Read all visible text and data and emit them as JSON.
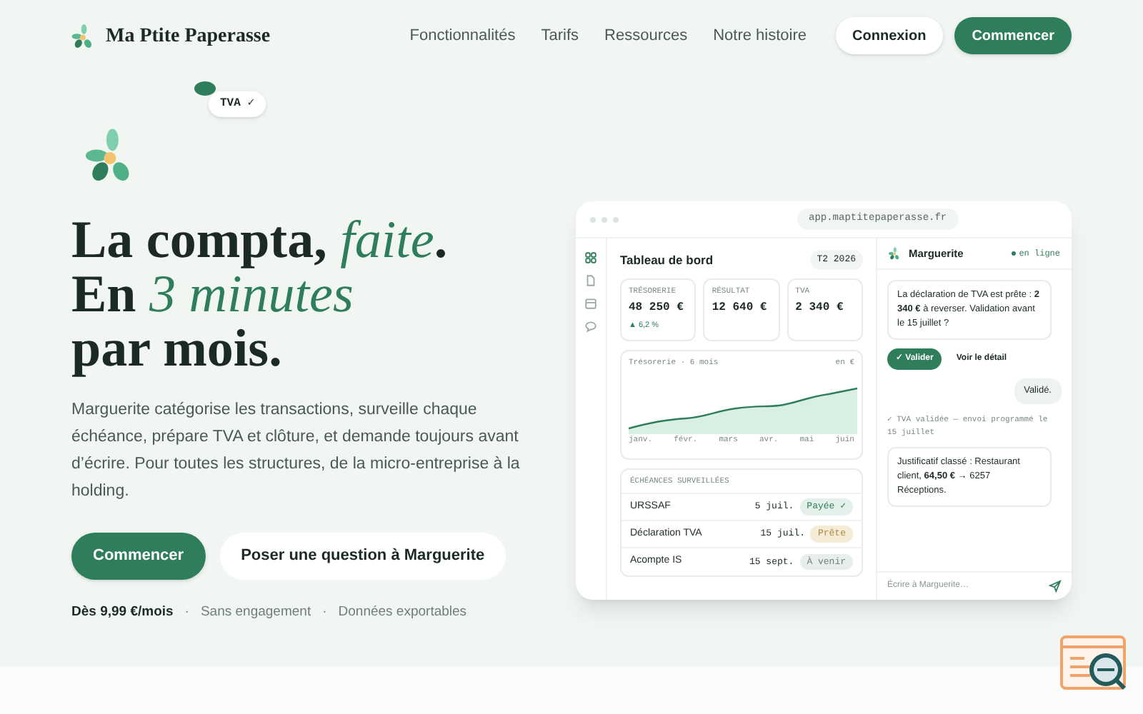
{
  "brand": "Ma Ptite Paperasse",
  "nav": [
    "Fonctionnalités",
    "Tarifs",
    "Ressources",
    "Notre histoire"
  ],
  "login": "Connexion",
  "cta": "Commencer",
  "floating_tag": "TVA ✓",
  "headline": [
    {
      "text": "La compta, ",
      "accent": "faite",
      "end": "."
    },
    {
      "text": "En ",
      "accent": "3 minutes"
    },
    {
      "text": "par mois."
    }
  ],
  "intro": "Marguerite catégorise les transactions, surveille chaque échéance, prépare TVA et clôture, et demande toujours avant d’écrire. Pour toutes les structures, de la micro-entreprise à la holding.",
  "primary_button": "Commencer",
  "secondary_button": "Poser une question à Marguerite",
  "perks": [
    "Dès 9,99 €/mois",
    "Sans engagement",
    "Données exportables"
  ],
  "perk_separator": "·",
  "app": {
    "url": "app.maptitepaperasse.fr",
    "sidebar": [
      {
        "selected": true
      },
      {
        "selected": false
      },
      {
        "selected": false
      },
      {
        "selected": false
      }
    ],
    "title": "Tableau de bord",
    "period": "T2 2026",
    "kpis": [
      {
        "label": "TRÉSORERIE",
        "value": "48 250 €",
        "delta": "▲ 6,2 %"
      },
      {
        "label": "RÉSULTAT",
        "value": "12 640 €"
      },
      {
        "label": "TVA",
        "value": "2 340 €"
      }
    ],
    "chart": {
      "title": "Trésorerie · 6 mois",
      "unit": "en €",
      "months": [
        "janv.",
        "févr.",
        "mars",
        "avr.",
        "mai",
        "juin"
      ]
    },
    "deadlines_title": "ÉCHÉANCES SURVEILLÉES",
    "deadlines": [
      {
        "name": "URSSAF",
        "date": "5 juil.",
        "status": "Payée ✓",
        "kind": "paid"
      },
      {
        "name": "Déclaration TVA",
        "date": "15 juil.",
        "status": "Prête",
        "kind": "ready"
      },
      {
        "name": "Acompte IS",
        "date": "15 sept.",
        "status": "À venir",
        "kind": "upcoming"
      }
    ],
    "chat": {
      "name": "Marguerite",
      "presence": "en ligne",
      "messages": [
        {
          "kind": "bot",
          "text": "La déclaration de TVA est prête : **2 340 €** à reverser. Validation avant le 15 juillet ?"
        },
        {
          "kind": "actions",
          "primary": "✓ Valider",
          "secondary": "Voir le détail"
        },
        {
          "kind": "user",
          "text": "Validé."
        },
        {
          "kind": "note",
          "text": "✓ TVA validée — envoi programmé le 15 juillet"
        },
        {
          "kind": "bot",
          "text": "Justificatif classé : Restaurant client, **64,50 €** → 6257 Réceptions."
        }
      ],
      "placeholder": "Écrire à Marguerite…"
    }
  }
}
